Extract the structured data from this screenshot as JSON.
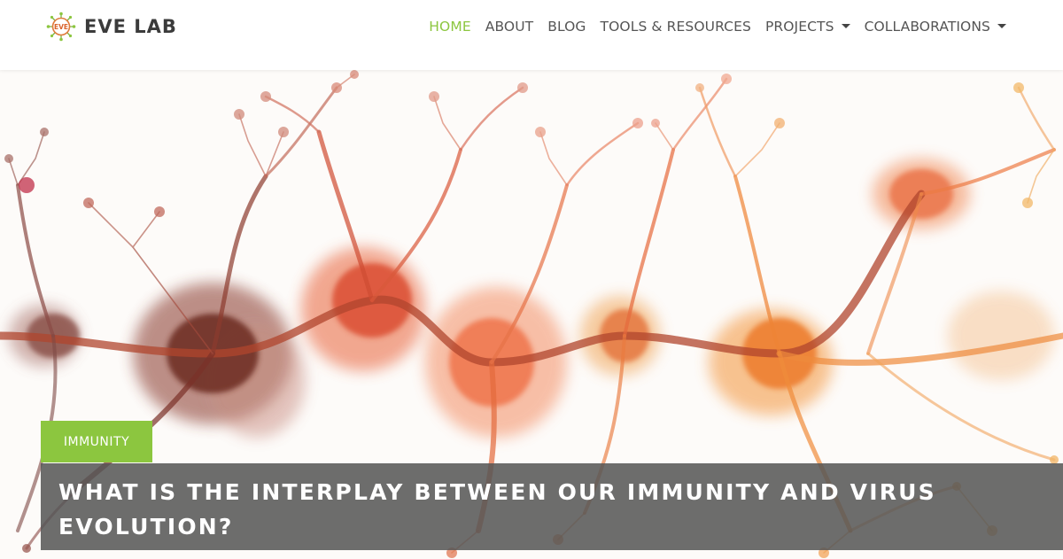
{
  "brand": {
    "name": "EVE LAB",
    "logo_text": "EVE",
    "logo_icon": "eve-logo-icon"
  },
  "nav": {
    "items": [
      {
        "label": "HOME",
        "active": true,
        "has_dropdown": false
      },
      {
        "label": "ABOUT",
        "active": false,
        "has_dropdown": false
      },
      {
        "label": "BLOG",
        "active": false,
        "has_dropdown": false
      },
      {
        "label": "TOOLS & RESOURCES",
        "active": false,
        "has_dropdown": false
      },
      {
        "label": "PROJECTS",
        "active": false,
        "has_dropdown": true
      },
      {
        "label": "COLLABORATIONS",
        "active": false,
        "has_dropdown": true
      }
    ]
  },
  "hero": {
    "image_icon": "neuron-watercolor-illustration",
    "category": "IMMUNITY",
    "title": "WHAT IS THE INTERPLAY BETWEEN OUR IMMUNITY AND VIRUS EVOLUTION?"
  },
  "colors": {
    "accent": "#8cc63f",
    "nav_text": "#555555",
    "brand_text": "#3b3b3b",
    "title_overlay": "#555555",
    "title_text": "#ffffff"
  }
}
